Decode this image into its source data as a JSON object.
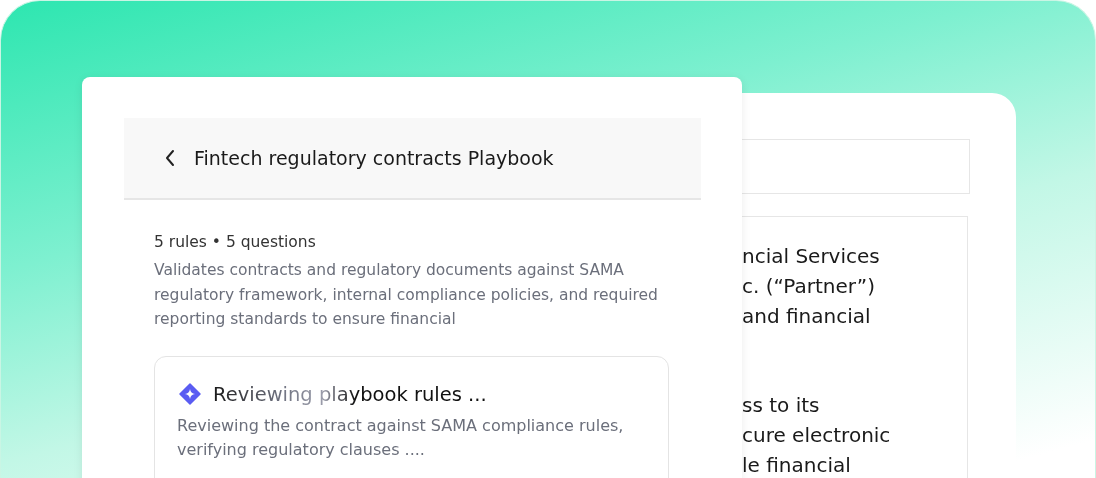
{
  "document_panel": {
    "paragraphs": [
      {
        "lines": [
          "ncial Services",
          "c. (“Partner”)",
          "and financial"
        ]
      },
      {
        "lines": [
          "ss to its",
          "cure electronic",
          "le financial"
        ]
      }
    ]
  },
  "playbook_panel": {
    "title": "Fintech regulatory contracts Playbook",
    "summary": "5 rules • 5 questions",
    "description": "Validates contracts and regulatory documents against SAMA regulatory framework, internal compliance policies, and required reporting standards to ensure financial",
    "status_card": {
      "title": "Reviewing playbook rules ...",
      "text": "Reviewing the contract against SAMA compliance rules, verifying regulatory clauses ...."
    }
  }
}
